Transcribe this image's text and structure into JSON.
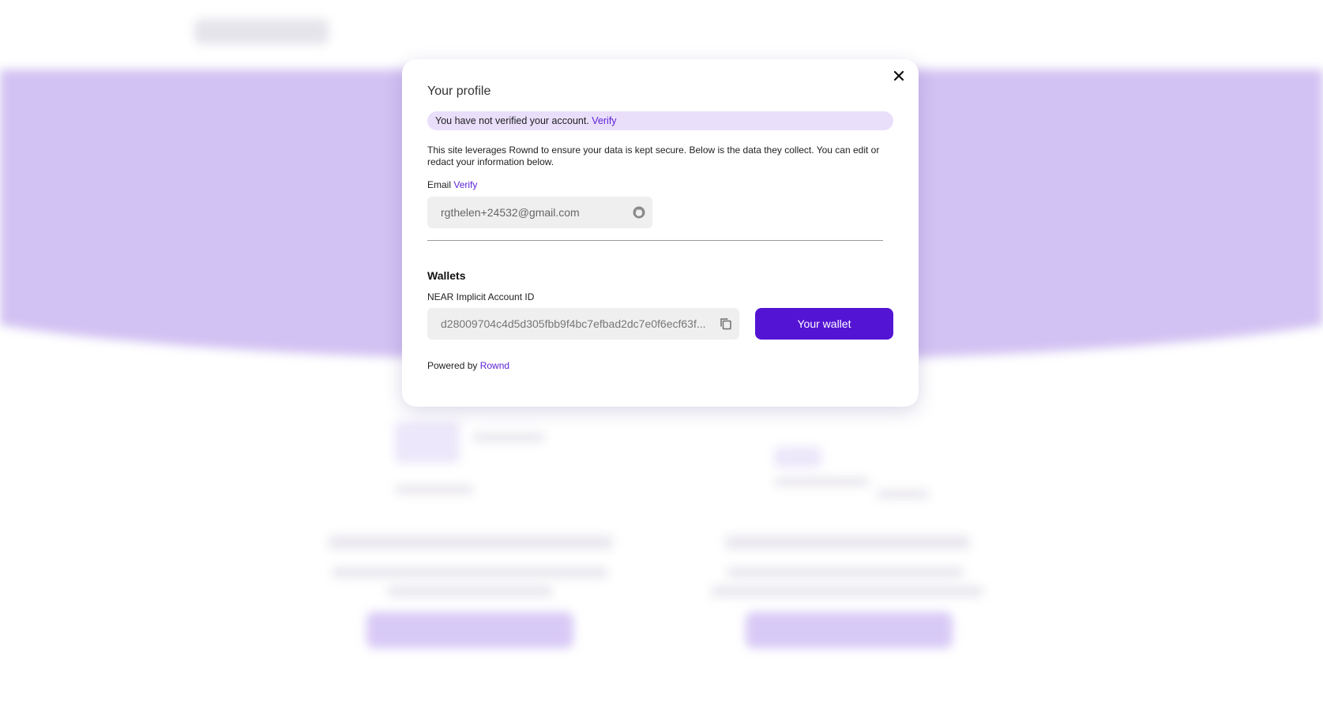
{
  "modal": {
    "title": "Your profile",
    "close_label": "✕",
    "banner": {
      "text": "You have not verified your account.",
      "link": "Verify"
    },
    "description": "This site leverages Rownd to ensure your data is kept secure. Below is the data they collect. You can edit or redact your information below.",
    "email": {
      "label": "Email",
      "verify_link": "Verify",
      "value": "rgthelen+24532@gmail.com",
      "icon": "github-icon"
    },
    "wallets": {
      "heading": "Wallets",
      "near_label": "NEAR Implicit Account ID",
      "account_id": "d28009704c4d5d305fbb9f4bc7efbad2dc7e0f6ecf63f...",
      "copy_icon": "copy-icon",
      "wallet_button": "Your wallet"
    },
    "powered_by": {
      "text": "Powered by",
      "link": "Rownd"
    }
  },
  "colors": {
    "accent": "#5414d4",
    "banner_bg": "#e9dffb",
    "hero_bg": "#cbb8f1",
    "field_bg": "#efefef"
  }
}
